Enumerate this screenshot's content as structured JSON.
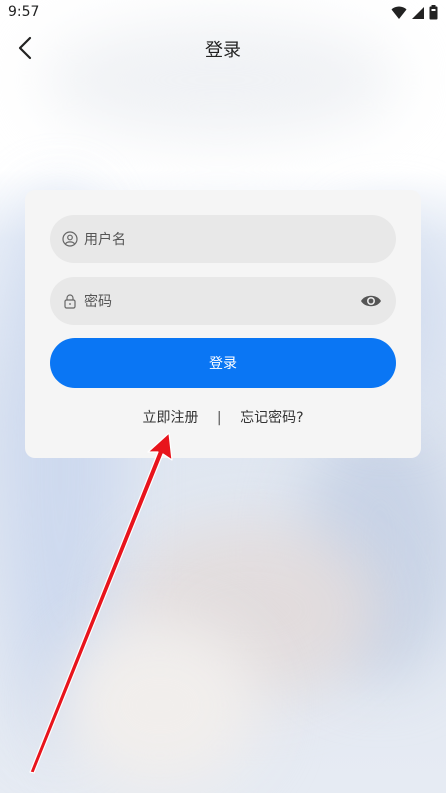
{
  "status": {
    "time": "9:57"
  },
  "header": {
    "title": "登录"
  },
  "form": {
    "username_placeholder": "用户名",
    "password_placeholder": "密码",
    "login_label": "登录"
  },
  "links": {
    "register": "立即注册",
    "separator": "|",
    "forgot": "忘记密码?"
  },
  "colors": {
    "primary": "#0a76f4",
    "annotation_arrow": "#e8141c"
  }
}
